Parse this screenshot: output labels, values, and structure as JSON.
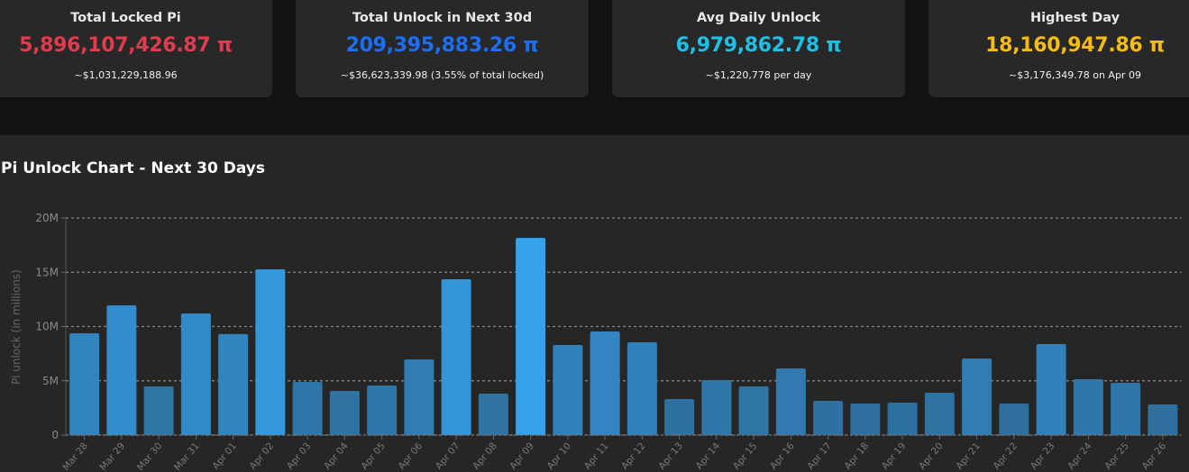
{
  "cards": [
    {
      "title": "Total Locked Pi",
      "value": "5,896,107,426.87 π",
      "sub": "~$1,031,229,188.96",
      "color": "#e23b4e"
    },
    {
      "title": "Total Unlock in Next 30d",
      "value": "209,395,883.26 π",
      "sub": "~$36,623,339.98 (3.55% of total locked)",
      "color": "#1c6ff5"
    },
    {
      "title": "Avg Daily Unlock",
      "value": "6,979,862.78 π",
      "sub": "~$1,220,778 per day",
      "color": "#1fc0e8"
    },
    {
      "title": "Highest Day",
      "value": "18,160,947.86 π",
      "sub": "~$3,176,349.78 on Apr 09",
      "color": "#f8bc0c"
    }
  ],
  "chart_data": {
    "type": "bar",
    "title": "Pi Unlock Chart - Next 30 Days",
    "ylabel": "Pi unlock (in millions)",
    "xlabel": "",
    "ylim": [
      0,
      20
    ],
    "yticks": [
      "0",
      "5M",
      "10M",
      "15M",
      "20M"
    ],
    "grid": true,
    "categories": [
      "Mar 28",
      "Mar 29",
      "Mar 30",
      "Mar 31",
      "Apr 01",
      "Apr 02",
      "Apr 03",
      "Apr 04",
      "Apr 05",
      "Apr 06",
      "Apr 07",
      "Apr 08",
      "Apr 09",
      "Apr 10",
      "Apr 11",
      "Apr 12",
      "Apr 13",
      "Apr 14",
      "Apr 15",
      "Apr 16",
      "Apr 17",
      "Apr 18",
      "Apr 19",
      "Apr 20",
      "Apr 21",
      "Apr 22",
      "Apr 23",
      "Apr 24",
      "Apr 25",
      "Apr 26"
    ],
    "values": [
      9.38,
      11.95,
      4.48,
      11.2,
      9.3,
      15.27,
      4.9,
      4.07,
      4.56,
      6.97,
      14.36,
      3.82,
      18.16,
      8.3,
      9.54,
      8.55,
      3.32,
      5.06,
      4.48,
      6.14,
      3.15,
      2.9,
      2.99,
      3.9,
      7.05,
      2.9,
      8.38,
      5.15,
      4.81,
      2.82
    ],
    "colors": {
      "low": "#2e6f9e",
      "high": "#36a2eb"
    }
  }
}
